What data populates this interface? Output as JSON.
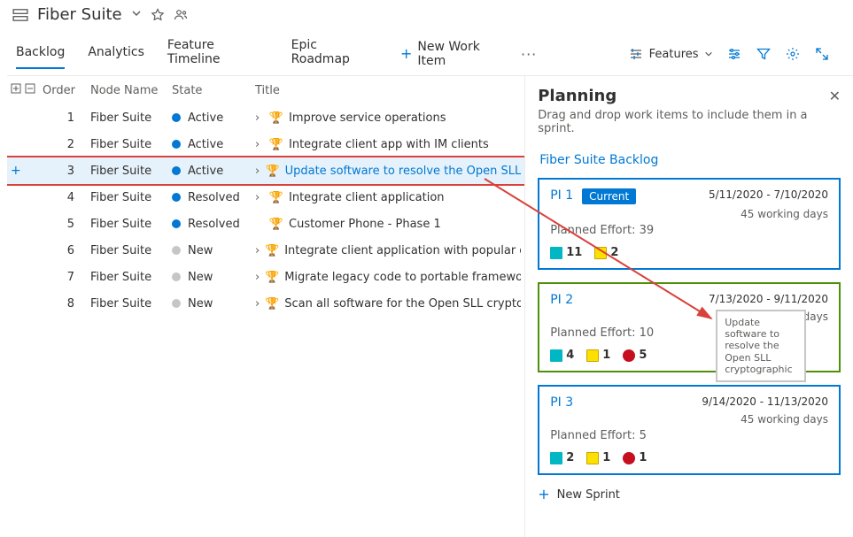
{
  "header": {
    "title": "Fiber Suite"
  },
  "tabs": [
    "Backlog",
    "Analytics",
    "Feature Timeline",
    "Epic Roadmap"
  ],
  "toolbar": {
    "newWorkItem": "New Work Item",
    "viewLabel": "Features"
  },
  "grid": {
    "columns": {
      "order": "Order",
      "node": "Node Name",
      "state": "State",
      "title": "Title"
    },
    "rows": [
      {
        "order": 1,
        "node": "Fiber Suite",
        "state": "Active",
        "stateClass": "state-active",
        "title": "Improve service operations",
        "expand": true
      },
      {
        "order": 2,
        "node": "Fiber Suite",
        "state": "Active",
        "stateClass": "state-active",
        "title": "Integrate client app with IM clients",
        "expand": true
      },
      {
        "order": 3,
        "node": "Fiber Suite",
        "state": "Active",
        "stateClass": "state-active",
        "title": "Update software to resolve the Open SLL",
        "expand": true,
        "selected": true,
        "link": true,
        "add": true
      },
      {
        "order": 4,
        "node": "Fiber Suite",
        "state": "Resolved",
        "stateClass": "state-resolved",
        "title": "Integrate client application",
        "expand": true
      },
      {
        "order": 5,
        "node": "Fiber Suite",
        "state": "Resolved",
        "stateClass": "state-resolved",
        "title": "Customer Phone - Phase 1",
        "expand": false
      },
      {
        "order": 6,
        "node": "Fiber Suite",
        "state": "New",
        "stateClass": "state-new",
        "title": "Integrate client application with popular e",
        "expand": true
      },
      {
        "order": 7,
        "node": "Fiber Suite",
        "state": "New",
        "stateClass": "state-new",
        "title": "Migrate legacy code to portable framewor",
        "expand": true
      },
      {
        "order": 8,
        "node": "Fiber Suite",
        "state": "New",
        "stateClass": "state-new",
        "title": "Scan all software for the Open SLL cryptog",
        "expand": true
      }
    ]
  },
  "panel": {
    "title": "Planning",
    "subtitle": "Drag and drop work items to include them in a sprint.",
    "backlogLink": "Fiber Suite Backlog",
    "newSprint": "New Sprint",
    "effortLabel": "Planned Effort:",
    "workingDaysLabel": "working days",
    "currentLabel": "Current",
    "ghostText": "Update software to resolve the Open SLL cryptographic",
    "sprints": [
      {
        "name": "PI 1",
        "dates": "5/11/2020 - 7/10/2020",
        "days": 45,
        "effort": 39,
        "current": true,
        "color": "blue",
        "stats": [
          {
            "icon": "books",
            "n": 11
          },
          {
            "icon": "badge",
            "n": 2
          }
        ]
      },
      {
        "name": "PI 2",
        "dates": "7/13/2020 - 9/11/2020",
        "days": 45,
        "effort": 10,
        "current": false,
        "color": "green",
        "ghost": true,
        "stats": [
          {
            "icon": "books",
            "n": 4
          },
          {
            "icon": "badge",
            "n": 1
          },
          {
            "icon": "bug",
            "n": 5
          }
        ]
      },
      {
        "name": "PI 3",
        "dates": "9/14/2020 - 11/13/2020",
        "days": 45,
        "effort": 5,
        "current": false,
        "color": "blue",
        "stats": [
          {
            "icon": "books",
            "n": 2
          },
          {
            "icon": "badge",
            "n": 1
          },
          {
            "icon": "bug",
            "n": 1
          }
        ]
      }
    ]
  }
}
